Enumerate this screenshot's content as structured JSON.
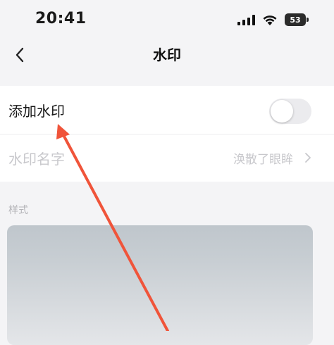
{
  "status_bar": {
    "time": "20:41",
    "battery_level": "53",
    "signal_icon": "signal-icon",
    "wifi_icon": "wifi-icon"
  },
  "nav": {
    "title": "水印",
    "back_icon": "chevron-left-icon"
  },
  "settings": {
    "add_watermark": {
      "label": "添加水印",
      "enabled": false
    },
    "watermark_name": {
      "label": "水印名字",
      "value": "涣散了眼眸"
    }
  },
  "style_section": {
    "label": "样式"
  },
  "annotation": {
    "arrow_color": "#f0543a"
  },
  "colors": {
    "background": "#f4f4f6",
    "card": "#ffffff",
    "disabled_text": "#c8c8cc",
    "toggle_off": "#ebebee"
  }
}
